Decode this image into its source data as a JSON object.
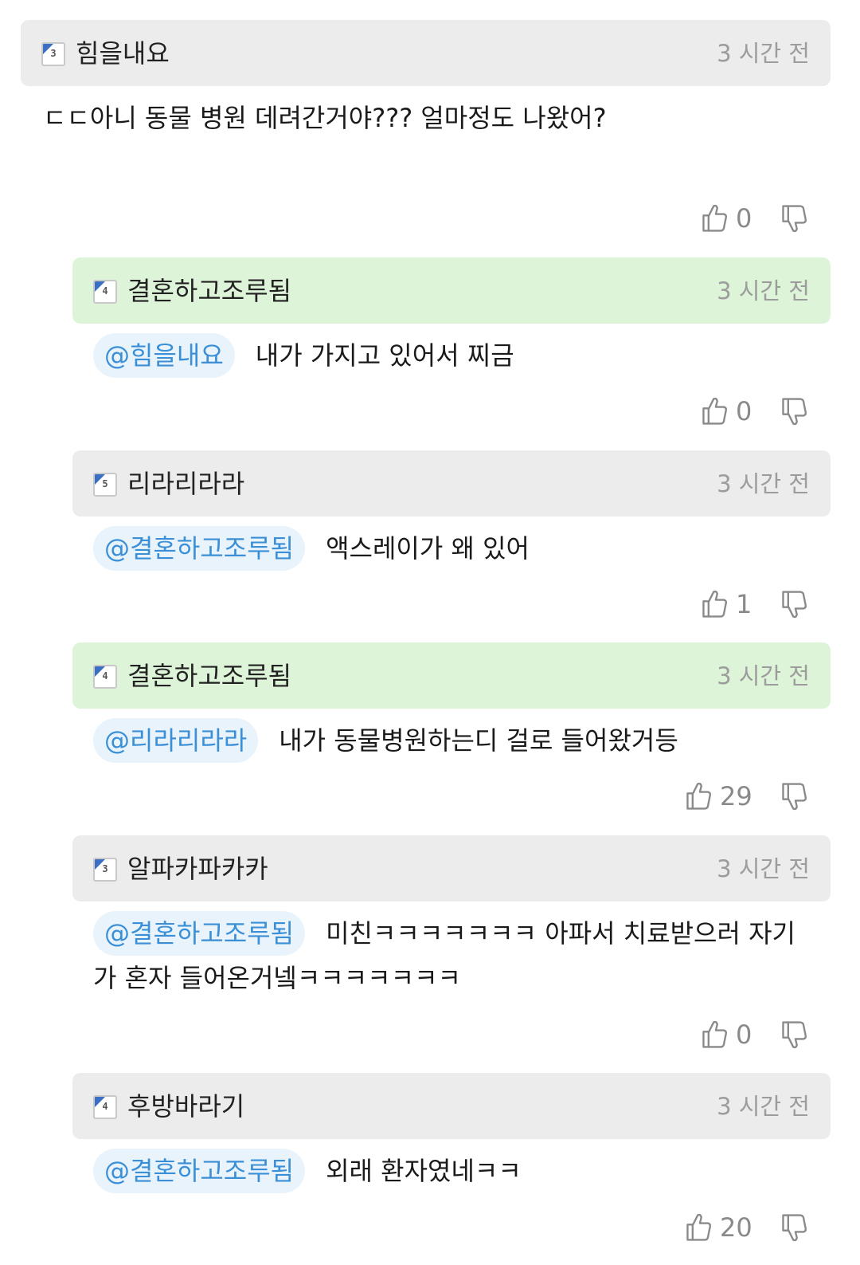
{
  "comments": [
    {
      "level": "3",
      "nickname": "힘을내요",
      "time": "3 시간 전",
      "mention": "",
      "text": "ㄷㄷ아니 동물 병원 데려간거야??? 얼마정도 나왔어?",
      "likes": "0"
    },
    {
      "level": "4",
      "nickname": "결혼하고조루됨",
      "time": "3 시간 전",
      "mention": "@힘을내요",
      "text": "내가 가지고 있어서 찌금",
      "likes": "0"
    },
    {
      "level": "5",
      "nickname": "리라리라라",
      "time": "3 시간 전",
      "mention": "@결혼하고조루됨",
      "text": "액스레이가 왜 있어",
      "likes": "1"
    },
    {
      "level": "4",
      "nickname": "결혼하고조루됨",
      "time": "3 시간 전",
      "mention": "@리라리라라",
      "text": "내가 동물병원하는디 걸로 들어왔거등",
      "likes": "29"
    },
    {
      "level": "3",
      "nickname": "알파카파카카",
      "time": "3 시간 전",
      "mention": "@결혼하고조루됨",
      "text": "미친ㅋㅋㅋㅋㅋㅋㅋ 아파서 치료받으러 자기",
      "text2": "가 혼자 들어온거넼ㅋㅋㅋㅋㅋㅋㅋ",
      "likes": "0"
    },
    {
      "level": "4",
      "nickname": "후방바라기",
      "time": "3 시간 전",
      "mention": "@결혼하고조루됨",
      "text": "외래 환자였네ㅋㅋ",
      "likes": "20"
    }
  ],
  "colors": {
    "author_header": "#def4d8",
    "header": "#ececec",
    "mention": "#3a8fd6",
    "mention_bg": "#e9f3fb"
  },
  "icons": {
    "like": "thumbs-up-icon",
    "dislike": "thumbs-down-icon",
    "level": "level-badge-icon"
  }
}
